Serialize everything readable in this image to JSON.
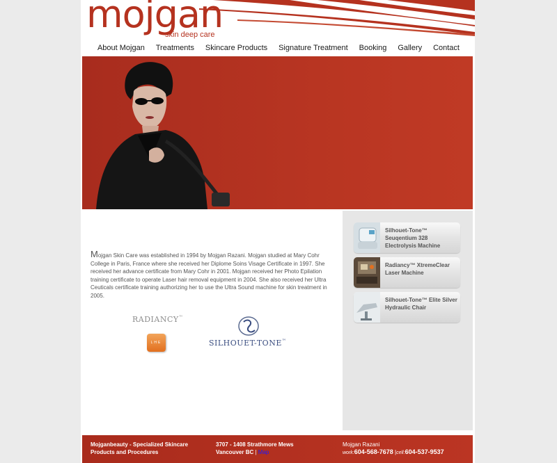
{
  "brand": {
    "name": "mojgan",
    "tagline": "skin deep care"
  },
  "nav": {
    "items": [
      "About Mojgan",
      "Treatments",
      "Skincare Products",
      "Signature Treatment",
      "Booking",
      "Gallery",
      "Contact"
    ]
  },
  "about": {
    "drop_letter": "M",
    "text": "ojgan Skin Care was established in 1994 by Mojgan Razani. Mojgan studied at Mary Cohr College in Paris, France where she received her Diplome Soins Visage Certificate in 1997. She received her advance certificate from Mary Cohr in 2001. Mojgan received her Photo Epilation training certificate to operate Laser hair removal equipment in 2004. She also received her Ultra Ceuticals certificate training authorizing her to use the Ultra Sound machine for skin treatment in 2005."
  },
  "partners": {
    "radiancy": "RADIANCY",
    "radiancy_tm": "™",
    "radiancy_badge": "LHE",
    "silhouette": "SILHOUET-TONE",
    "silhouette_tm": "™"
  },
  "products": [
    {
      "label": "Silhouet-Tone™ Seuqentium 328 Electrolysis Machine",
      "icon": "electrolysis-machine-icon"
    },
    {
      "label": "Radiancy™ XtremeClear Laser Machine",
      "icon": "laser-machine-icon"
    },
    {
      "label": "Silhouet-Tone™ Elite Silver Hydraulic Chair",
      "icon": "hydraulic-chair-icon"
    }
  ],
  "footer": {
    "company_line1": "Mojganbeauty - Specialized Skincare",
    "company_line2": "Products and Procedures",
    "address_line1": "3707 - 1408 Strathmore Mews",
    "address_line2": "Vancouver BC",
    "separator": "|",
    "map_link": "Map",
    "contact_name": "Mojgan Razani",
    "work_label": "work:",
    "work_phone": "604-568-7678",
    "cell_label": "cell:",
    "cell_phone": "604-537-9537"
  },
  "colors": {
    "brand_red": "#b5321f",
    "sidebar_bg": "#e6e6e6",
    "page_bg": "#ebebeb"
  }
}
